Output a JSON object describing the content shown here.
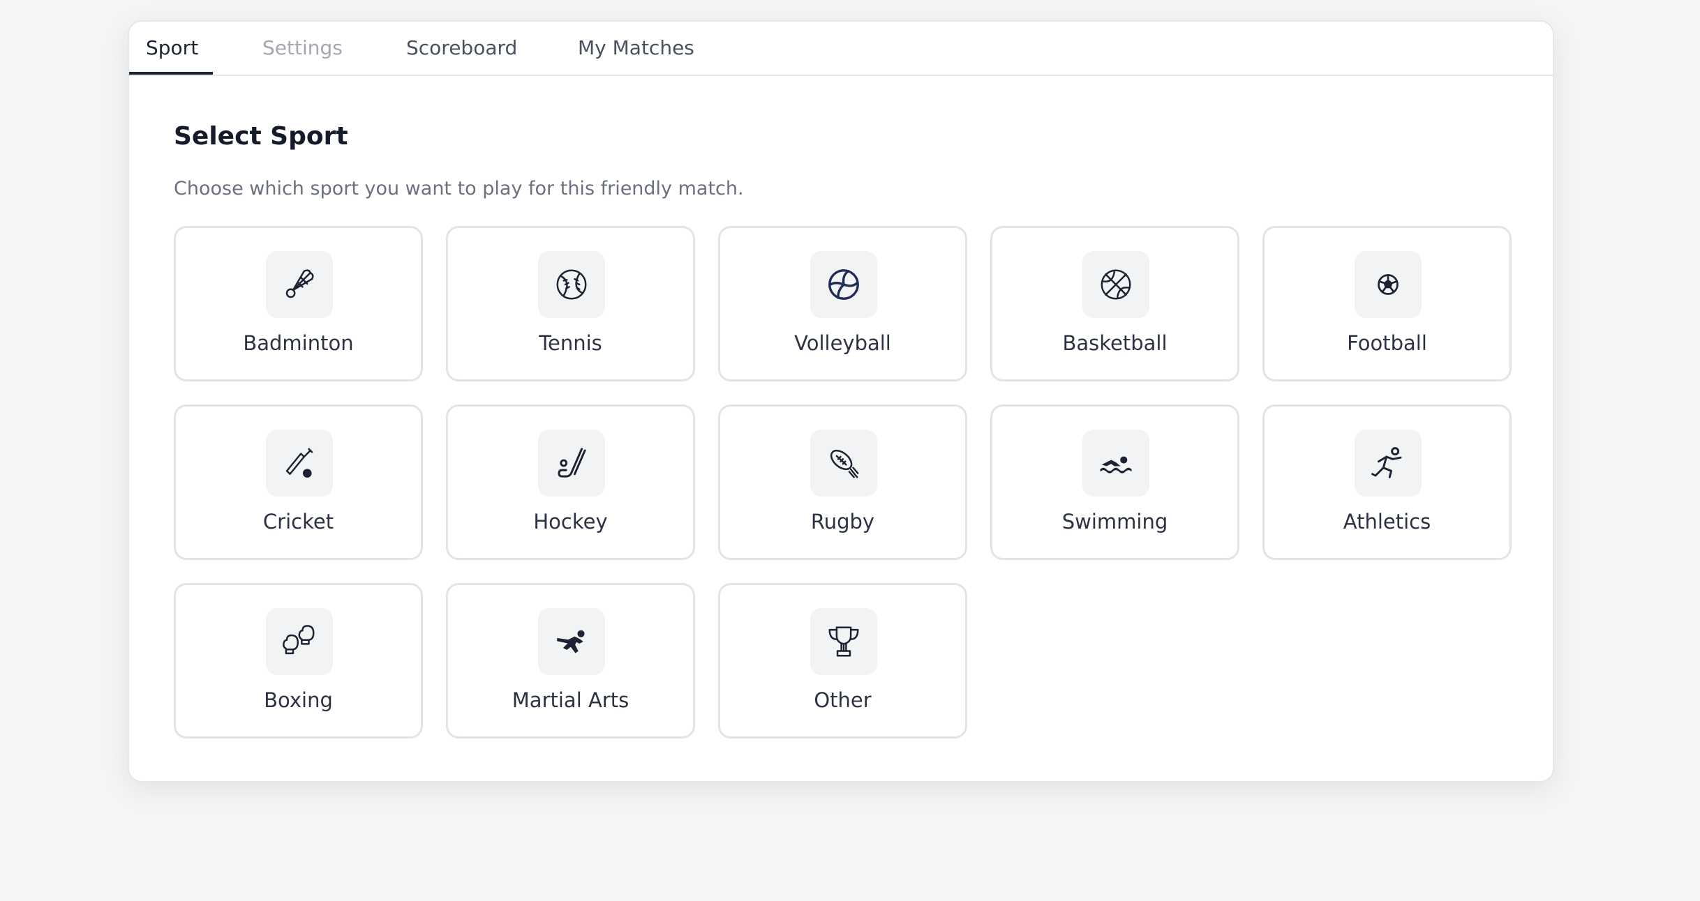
{
  "tabs": [
    {
      "label": "Sport",
      "state": "active"
    },
    {
      "label": "Settings",
      "state": "disabled"
    },
    {
      "label": "Scoreboard",
      "state": "normal"
    },
    {
      "label": "My Matches",
      "state": "normal"
    }
  ],
  "main": {
    "title": "Select Sport",
    "subtitle": "Choose which sport you want to play for this friendly match."
  },
  "sports": [
    {
      "label": "Badminton",
      "icon": "shuttlecock-icon"
    },
    {
      "label": "Tennis",
      "icon": "tennis-ball-icon"
    },
    {
      "label": "Volleyball",
      "icon": "volleyball-icon"
    },
    {
      "label": "Basketball",
      "icon": "basketball-icon"
    },
    {
      "label": "Football",
      "icon": "football-icon"
    },
    {
      "label": "Cricket",
      "icon": "cricket-bat-icon"
    },
    {
      "label": "Hockey",
      "icon": "hockey-stick-icon"
    },
    {
      "label": "Rugby",
      "icon": "rugby-ball-icon"
    },
    {
      "label": "Swimming",
      "icon": "swimmer-icon"
    },
    {
      "label": "Athletics",
      "icon": "runner-icon"
    },
    {
      "label": "Boxing",
      "icon": "boxing-gloves-icon"
    },
    {
      "label": "Martial Arts",
      "icon": "martial-arts-icon"
    },
    {
      "label": "Other",
      "icon": "trophy-icon"
    }
  ],
  "colors": {
    "accent": "#1d2333",
    "tile_border": "#e3e4e8",
    "icon_bg": "#f2f3f5",
    "muted_text": "#6b7080",
    "disabled_tab": "#a4a8b1"
  }
}
